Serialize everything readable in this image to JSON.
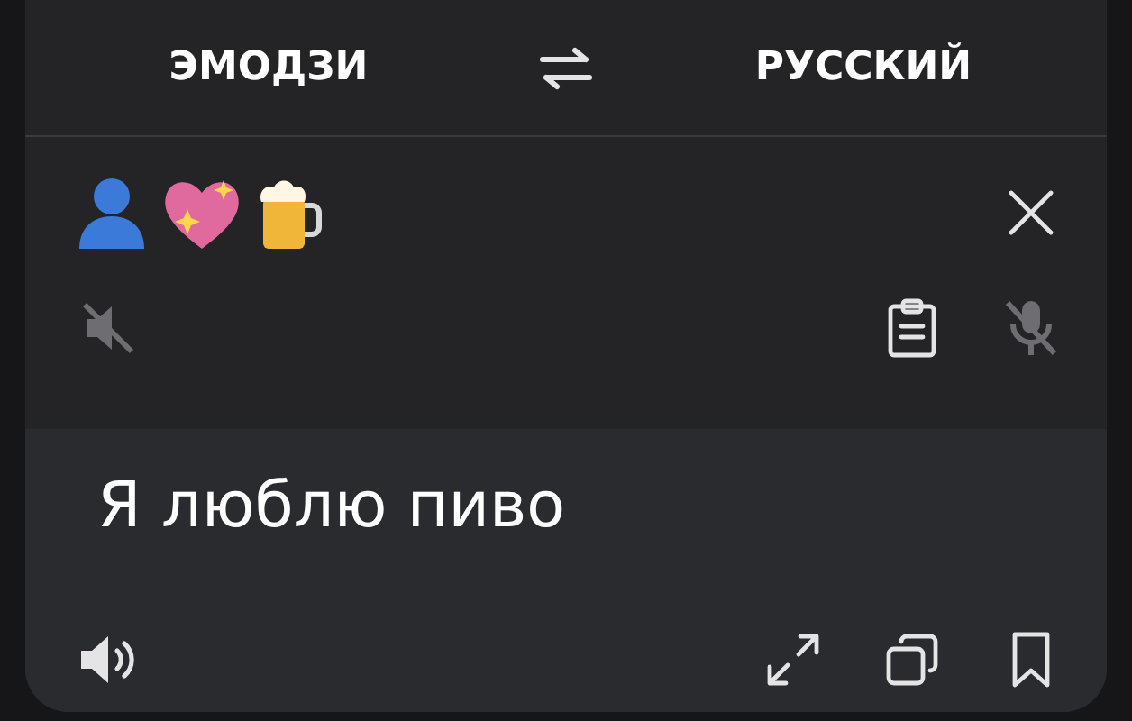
{
  "languages": {
    "source": "ЭМОДЗИ",
    "target": "РУССКИЙ"
  },
  "input": {
    "speaker_disabled": true,
    "mic_disabled": true
  },
  "output": {
    "text": "Я люблю пиво"
  }
}
